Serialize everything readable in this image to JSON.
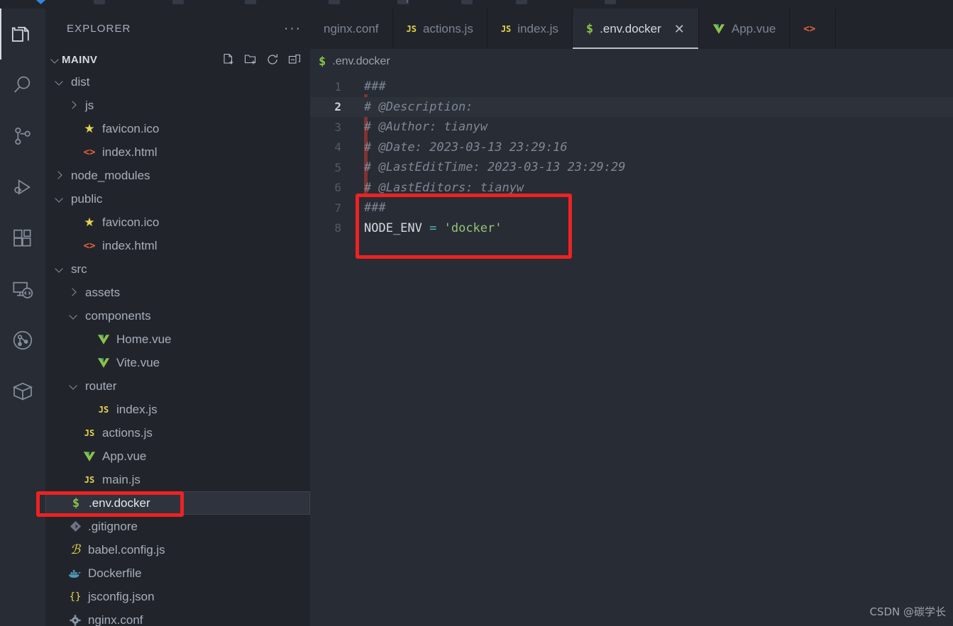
{
  "window": {
    "theme_bg_editor": "#282c34",
    "theme_bg_sidebar": "#21252b",
    "accent_red": "#ee2222"
  },
  "activity_bar": {
    "items": [
      {
        "name": "explorer",
        "icon": "files-icon",
        "active": true
      },
      {
        "name": "search",
        "icon": "search-icon",
        "active": false
      },
      {
        "name": "source-control",
        "icon": "source-control-icon",
        "active": false
      },
      {
        "name": "run-and-debug",
        "icon": "run-debug-icon",
        "active": false
      },
      {
        "name": "extensions",
        "icon": "extensions-icon",
        "active": false
      },
      {
        "name": "remote-explorer",
        "icon": "remote-explorer-icon",
        "active": false
      },
      {
        "name": "test-graph",
        "icon": "circle-graph-icon",
        "active": false
      },
      {
        "name": "package-explorer",
        "icon": "package-box-icon",
        "active": false
      }
    ]
  },
  "sidebar": {
    "title": "EXPLORER",
    "more_actions": "···",
    "section": {
      "label": "MAINV",
      "expanded": true,
      "actions": [
        {
          "name": "new-file",
          "icon": "new-file-icon"
        },
        {
          "name": "new-folder",
          "icon": "new-folder-icon"
        },
        {
          "name": "refresh",
          "icon": "refresh-icon"
        },
        {
          "name": "collapse-all",
          "icon": "collapse-all-icon"
        }
      ]
    },
    "tree": [
      {
        "label": "dist",
        "indent": 1,
        "type": "folder",
        "expanded": true,
        "icon": "chevron-down-icon",
        "selected": false
      },
      {
        "label": "js",
        "indent": 2,
        "type": "folder",
        "expanded": false,
        "icon": "chevron-right-icon",
        "selected": false
      },
      {
        "label": "favicon.ico",
        "indent": 2,
        "type": "file",
        "icon": "star-icon",
        "selected": false
      },
      {
        "label": "index.html",
        "indent": 2,
        "type": "file",
        "icon": "html-icon",
        "selected": false
      },
      {
        "label": "node_modules",
        "indent": 1,
        "type": "folder",
        "expanded": false,
        "icon": "chevron-right-icon",
        "selected": false
      },
      {
        "label": "public",
        "indent": 1,
        "type": "folder",
        "expanded": true,
        "icon": "chevron-down-icon",
        "selected": false
      },
      {
        "label": "favicon.ico",
        "indent": 2,
        "type": "file",
        "icon": "star-icon",
        "selected": false
      },
      {
        "label": "index.html",
        "indent": 2,
        "type": "file",
        "icon": "html-icon",
        "selected": false
      },
      {
        "label": "src",
        "indent": 1,
        "type": "folder",
        "expanded": true,
        "icon": "chevron-down-icon",
        "selected": false
      },
      {
        "label": "assets",
        "indent": 2,
        "type": "folder",
        "expanded": false,
        "icon": "chevron-right-icon",
        "selected": false
      },
      {
        "label": "components",
        "indent": 2,
        "type": "folder",
        "expanded": true,
        "icon": "chevron-down-icon",
        "selected": false
      },
      {
        "label": "Home.vue",
        "indent": 3,
        "type": "file",
        "icon": "vue-icon",
        "selected": false
      },
      {
        "label": "Vite.vue",
        "indent": 3,
        "type": "file",
        "icon": "vue-icon",
        "selected": false
      },
      {
        "label": "router",
        "indent": 2,
        "type": "folder",
        "expanded": true,
        "icon": "chevron-down-icon",
        "selected": false
      },
      {
        "label": "index.js",
        "indent": 3,
        "type": "file",
        "icon": "js-icon",
        "selected": false
      },
      {
        "label": "actions.js",
        "indent": 2,
        "type": "file",
        "icon": "js-icon",
        "selected": false
      },
      {
        "label": "App.vue",
        "indent": 2,
        "type": "file",
        "icon": "vue-icon",
        "selected": false
      },
      {
        "label": "main.js",
        "indent": 2,
        "type": "file",
        "icon": "js-icon",
        "selected": false
      },
      {
        "label": ".env.docker",
        "indent": 1,
        "type": "file",
        "icon": "env-dollar-icon",
        "selected": true
      },
      {
        "label": ".gitignore",
        "indent": 1,
        "type": "file",
        "icon": "git-icon",
        "selected": false
      },
      {
        "label": "babel.config.js",
        "indent": 1,
        "type": "file",
        "icon": "babel-icon",
        "selected": false
      },
      {
        "label": "Dockerfile",
        "indent": 1,
        "type": "file",
        "icon": "docker-icon",
        "selected": false
      },
      {
        "label": "jsconfig.json",
        "indent": 1,
        "type": "file",
        "icon": "json-icon",
        "selected": false
      },
      {
        "label": "nginx.conf",
        "indent": 1,
        "type": "file",
        "icon": "gear-icon",
        "selected": false
      }
    ]
  },
  "tabs": [
    {
      "label": "nginx.conf",
      "icon": "",
      "active": false,
      "closable": false
    },
    {
      "label": "actions.js",
      "icon": "js-icon",
      "active": false,
      "closable": false
    },
    {
      "label": "index.js",
      "icon": "js-icon",
      "active": false,
      "closable": false
    },
    {
      "label": ".env.docker",
      "icon": "env-dollar-icon",
      "active": true,
      "closable": true,
      "close_label": "✕"
    },
    {
      "label": "App.vue",
      "icon": "vue-icon",
      "active": false,
      "closable": false
    },
    {
      "label": "",
      "icon": "html-icon",
      "active": false,
      "closable": false
    }
  ],
  "breadcrumb": {
    "icon": "env-dollar-icon",
    "label": ".env.docker"
  },
  "editor": {
    "file_name": ".env.docker",
    "current_line": 2,
    "lines": [
      {
        "num": "1",
        "segments": [
          {
            "text": "###",
            "style": "cmt"
          }
        ]
      },
      {
        "num": "2",
        "segments": [
          {
            "text": "# @Description:",
            "style": "cmt"
          }
        ]
      },
      {
        "num": "3",
        "segments": [
          {
            "text": "# @Author: tianyw",
            "style": "cmt"
          }
        ]
      },
      {
        "num": "4",
        "segments": [
          {
            "text": "# @Date: 2023-03-13 23:29:16",
            "style": "cmt"
          }
        ]
      },
      {
        "num": "5",
        "segments": [
          {
            "text": "# @LastEditTime: 2023-03-13 23:29:29",
            "style": "cmt"
          }
        ]
      },
      {
        "num": "6",
        "segments": [
          {
            "text": "# @LastEditors: tianyw",
            "style": "cmt"
          }
        ]
      },
      {
        "num": "7",
        "segments": [
          {
            "text": "###",
            "style": "cmt"
          }
        ]
      },
      {
        "num": "8",
        "segments": [
          {
            "text": "NODE_ENV ",
            "style": "var"
          },
          {
            "text": "= ",
            "style": "op"
          },
          {
            "text": "'docker'",
            "style": "str"
          }
        ]
      }
    ]
  },
  "annotations": [
    {
      "name": "code-highlight-box",
      "target": "NODE_ENV = 'docker'",
      "color": "#ee2222"
    },
    {
      "name": "tree-highlight-box",
      "target": ".env.docker",
      "color": "#ee2222"
    }
  ],
  "watermark": {
    "text": "CSDN @碳学长"
  }
}
